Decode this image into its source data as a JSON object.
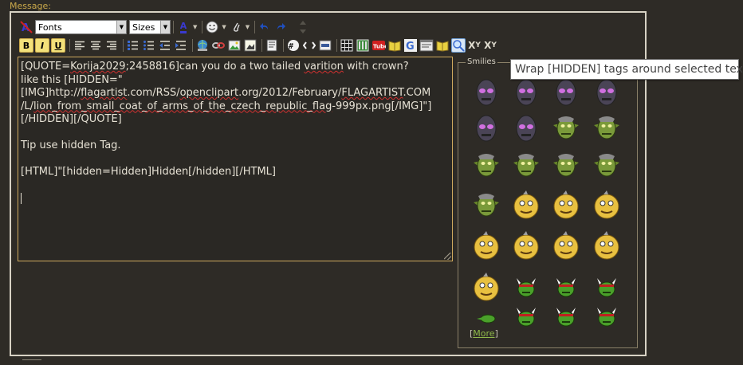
{
  "message_label": "Message:",
  "toolbar": {
    "font_select": "Fonts",
    "size_select": "Sizes",
    "bold": "B",
    "italic": "I",
    "underline": "U",
    "font_color_glyph": "A",
    "subscript": "X",
    "subscript_sub": "Y",
    "superscript": "X",
    "superscript_sup": "Y"
  },
  "editor": {
    "lines": [
      "[QUOTE=Korija2029;2458816]can you do a two tailed varition with crown?",
      "like this [HIDDEN=\"",
      "[IMG]http://flagartist.com/RSS/openclipart.org/2012/February/FLAGARTIST.COM",
      "/L/lion_from_small_coat_of_arms_of_the_czech_republic_flag-999px.png[/IMG]\"]",
      "[/HIDDEN][/QUOTE]",
      "",
      "Tip use hidden Tag.",
      "",
      "[HTML]\"[hidden=Hidden]Hidden[/hidden][/HTML]"
    ]
  },
  "smilies": {
    "legend": "Smilies",
    "more_prefix": "[",
    "more_link": "More",
    "more_suffix": "]"
  },
  "tooltip": "Wrap [HIDDEN] tags around selected text",
  "colors": {
    "background": "#2e2b26",
    "accent_text": "#c9a84a",
    "editor_border": "#cfa95e",
    "link": "#8fb84a"
  }
}
